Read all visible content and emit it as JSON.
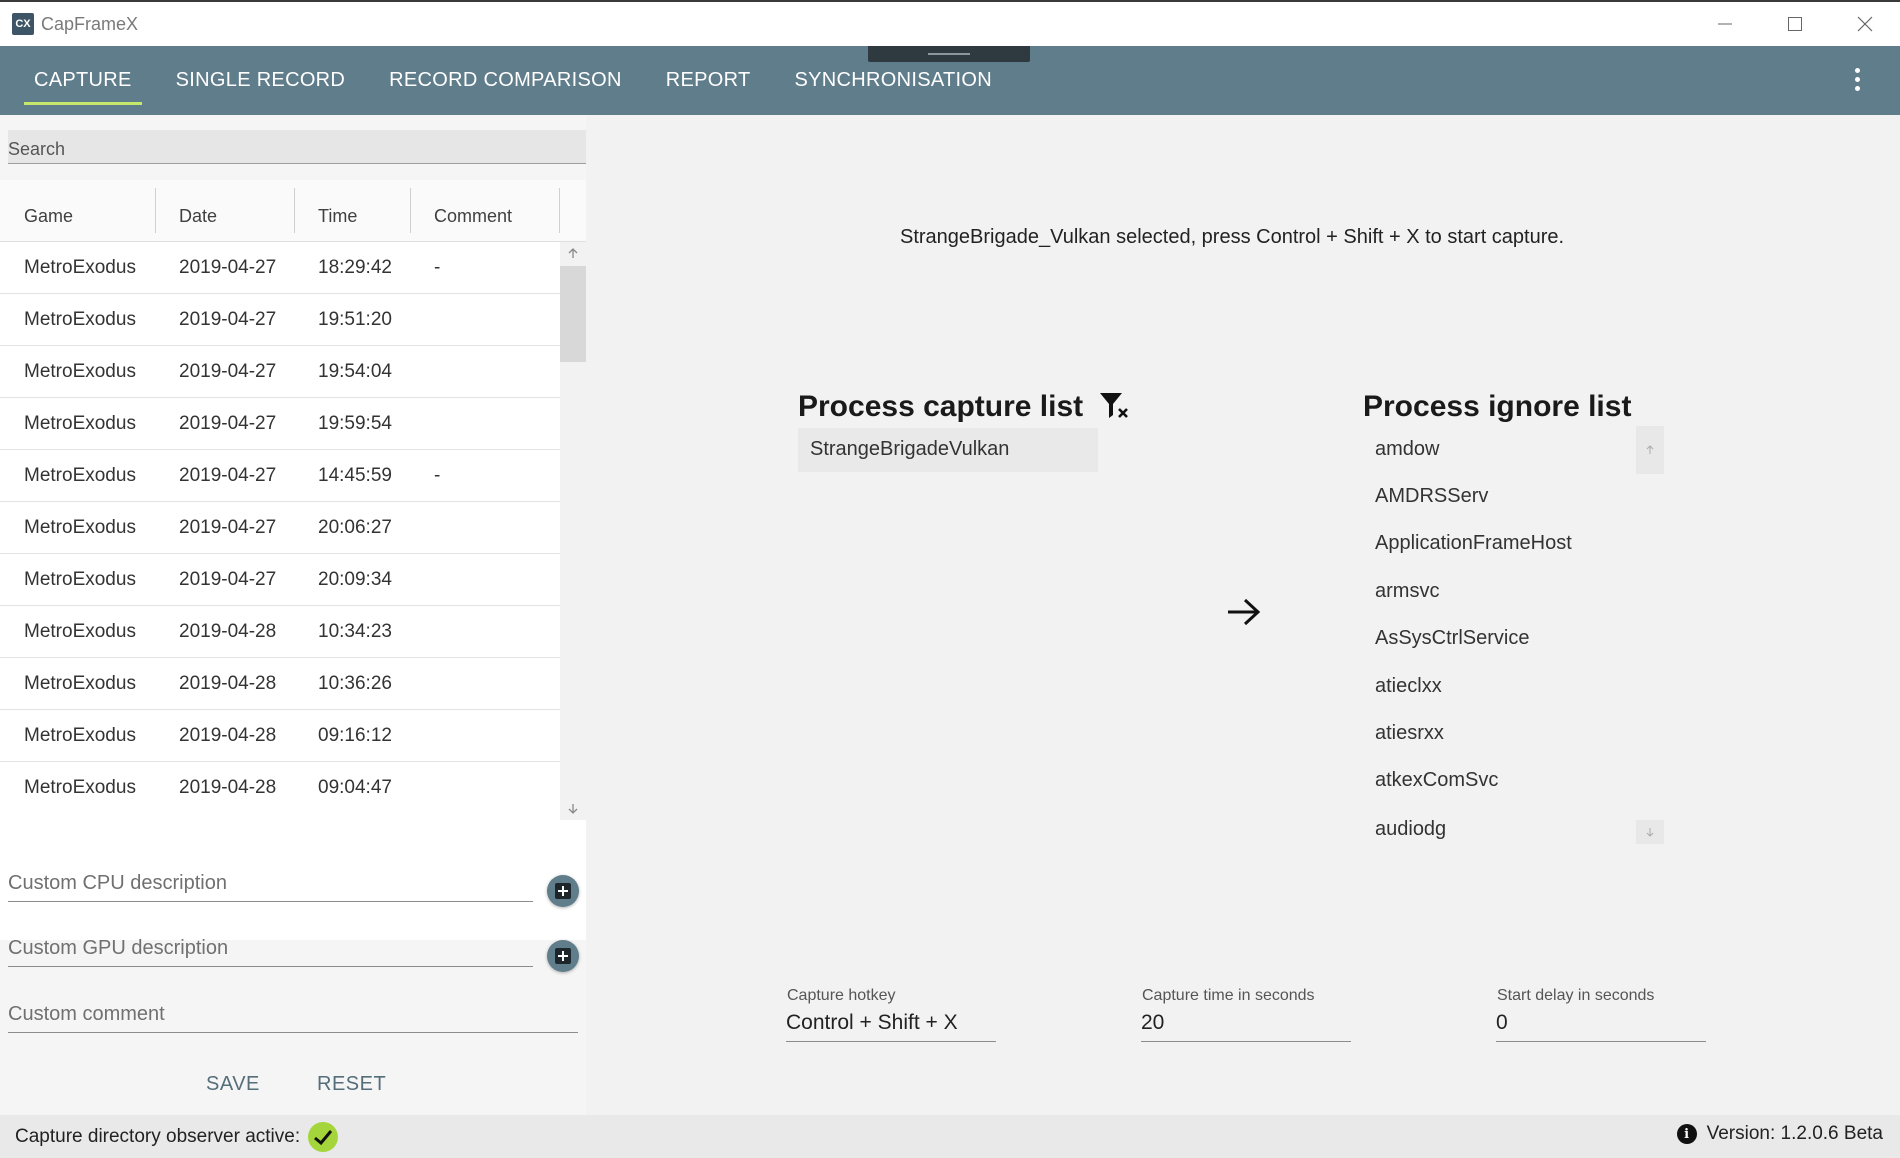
{
  "window": {
    "logo_text": "CX",
    "title": "CapFrameX"
  },
  "nav": {
    "tabs": [
      {
        "label": "CAPTURE",
        "active": true
      },
      {
        "label": "SINGLE RECORD",
        "active": false
      },
      {
        "label": "RECORD COMPARISON",
        "active": false
      },
      {
        "label": "REPORT",
        "active": false
      },
      {
        "label": "SYNCHRONISATION",
        "active": false
      }
    ]
  },
  "search": {
    "placeholder": "Search"
  },
  "table": {
    "headers": [
      "Game",
      "Date",
      "Time",
      "Comment"
    ],
    "rows": [
      {
        "game": "MetroExodus",
        "date": "2019-04-27",
        "time": "18:29:42",
        "comment": "-"
      },
      {
        "game": "MetroExodus",
        "date": "2019-04-27",
        "time": "19:51:20",
        "comment": ""
      },
      {
        "game": "MetroExodus",
        "date": "2019-04-27",
        "time": "19:54:04",
        "comment": ""
      },
      {
        "game": "MetroExodus",
        "date": "2019-04-27",
        "time": "19:59:54",
        "comment": ""
      },
      {
        "game": "MetroExodus",
        "date": "2019-04-27",
        "time": "14:45:59",
        "comment": "-"
      },
      {
        "game": "MetroExodus",
        "date": "2019-04-27",
        "time": "20:06:27",
        "comment": ""
      },
      {
        "game": "MetroExodus",
        "date": "2019-04-27",
        "time": "20:09:34",
        "comment": ""
      },
      {
        "game": "MetroExodus",
        "date": "2019-04-28",
        "time": "10:34:23",
        "comment": ""
      },
      {
        "game": "MetroExodus",
        "date": "2019-04-28",
        "time": "10:36:26",
        "comment": ""
      },
      {
        "game": "MetroExodus",
        "date": "2019-04-28",
        "time": "09:16:12",
        "comment": ""
      },
      {
        "game": "MetroExodus",
        "date": "2019-04-28",
        "time": "09:04:47",
        "comment": ""
      }
    ]
  },
  "form": {
    "cpu_placeholder": "Custom CPU description",
    "gpu_placeholder": "Custom GPU description",
    "comment_placeholder": "Custom comment",
    "save_label": "SAVE",
    "reset_label": "RESET"
  },
  "main": {
    "status_message": "StrangeBrigade_Vulkan selected, press Control + Shift + X to start capture.",
    "capture_list_title": "Process capture list",
    "capture_list": [
      "StrangeBrigadeVulkan"
    ],
    "ignore_list_title": "Process ignore list",
    "ignore_list": [
      "amdow",
      "AMDRSServ",
      "ApplicationFrameHost",
      "armsvc",
      "AsSysCtrlService",
      "atieclxx",
      "atiesrxx",
      "atkexComSvc",
      "audiodg"
    ]
  },
  "config": {
    "hotkey_label": "Capture hotkey",
    "hotkey_value": "Control + Shift + X",
    "capture_time_label": "Capture time in seconds",
    "capture_time_value": "20",
    "start_delay_label": "Start delay in seconds",
    "start_delay_value": "0"
  },
  "statusbar": {
    "observer_text": "Capture directory observer active:",
    "version_text": "Version:  1.2.0.6 Beta"
  },
  "colors": {
    "nav_bg": "#607d8b",
    "accent": "#c6e86a",
    "check": "#a4d63b"
  }
}
